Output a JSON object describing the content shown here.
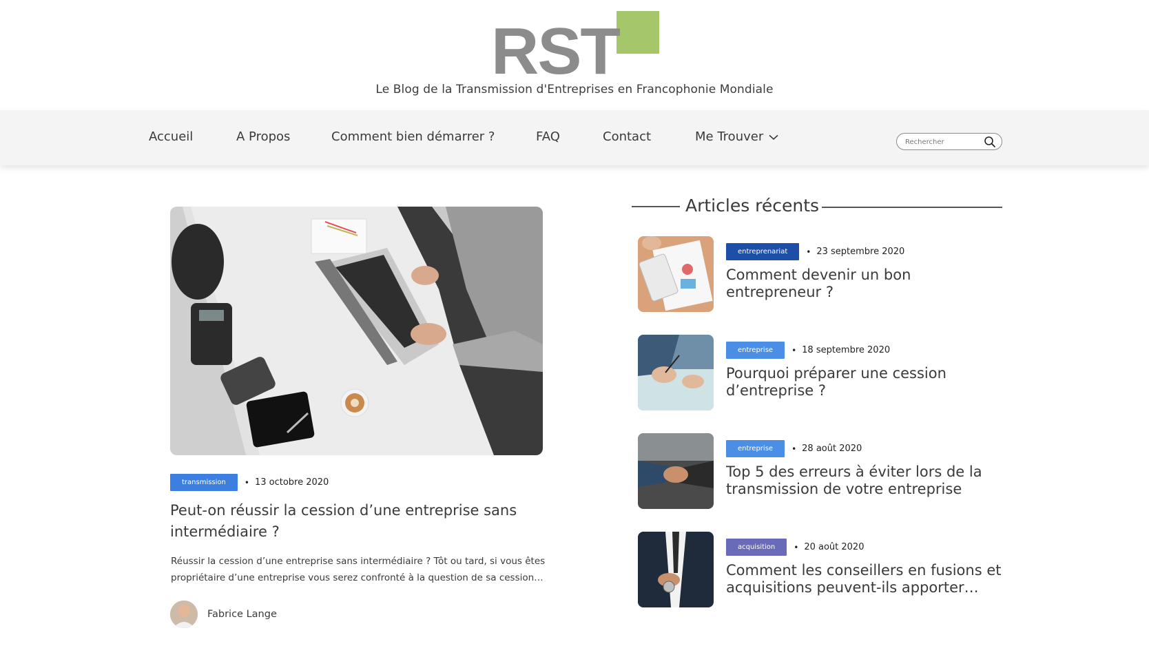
{
  "site": {
    "logo_text": "RST",
    "tagline": "Le Blog de la Transmission d'Entreprises en Francophonie Mondiale"
  },
  "nav": {
    "items": [
      {
        "label": "Accueil"
      },
      {
        "label": "A Propos"
      },
      {
        "label": "Comment bien démarrer ?"
      },
      {
        "label": "FAQ"
      },
      {
        "label": "Contact"
      },
      {
        "label": "Me Trouver"
      }
    ],
    "search_placeholder": "Rechercher"
  },
  "featured": {
    "category": "transmission",
    "category_color": "#3d7fe0",
    "date": "13 octobre 2020",
    "title": "Peut-on réussir la cession d’une entreprise sans intermédiaire ?",
    "excerpt": "Réussir la cession d’une entreprise sans intermédiaire ? Tôt ou tard, si vous êtes propriétaire d’une entreprise vous serez confronté à la question de sa cession…",
    "author": "Fabrice Lange"
  },
  "sidebar": {
    "title": "Articles récents",
    "articles": [
      {
        "category": "entreprenariat",
        "category_color": "#1d4fa8",
        "date": "23 septembre 2020",
        "title": "Comment devenir un bon entrepreneur ?"
      },
      {
        "category": "entreprise",
        "category_color": "#4a8ee6",
        "date": "18 septembre 2020",
        "title": "Pourquoi préparer une cession d’entreprise ?"
      },
      {
        "category": "entreprise",
        "category_color": "#4a8ee6",
        "date": "28 août 2020",
        "title": "Top 5 des erreurs à éviter lors de la transmission de votre entreprise"
      },
      {
        "category": "acquisition",
        "category_color": "#6a6bb8",
        "date": "20 août 2020",
        "title": "Comment les conseillers en fusions et acquisitions peuvent-ils apporter…"
      }
    ]
  },
  "colors": {
    "logo_grey": "#8c8c8c",
    "logo_green": "#a6c769"
  }
}
